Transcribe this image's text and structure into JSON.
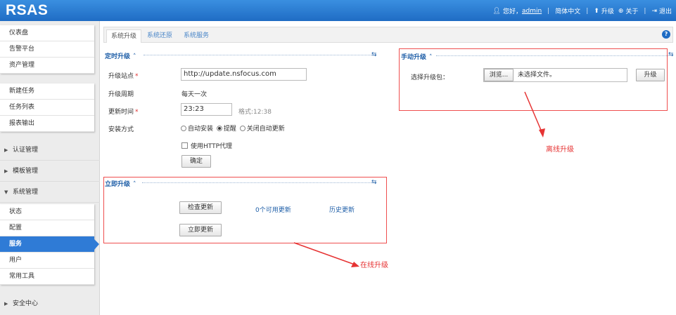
{
  "header": {
    "logo": "RSAS",
    "greeting": "您好，",
    "username": "admin",
    "language": "简体中文",
    "upgrade": "升级",
    "about": "关于",
    "logout": "退出"
  },
  "sidebar": {
    "group1": [
      "仪表盘",
      "告警平台",
      "资产管理"
    ],
    "group2": [
      "新建任务",
      "任务列表",
      "报表输出"
    ],
    "sections": {
      "auth": "认证管理",
      "template": "模板管理",
      "system": "系统管理",
      "security": "安全中心"
    },
    "system_items": [
      "状态",
      "配置",
      "服务",
      "用户",
      "常用工具"
    ],
    "active_item": "服务"
  },
  "tabs": [
    "系统升级",
    "系统还原",
    "系统服务"
  ],
  "help_icon": "?",
  "scheduled": {
    "title": "定时升级",
    "site_label": "升级站点",
    "site_value": "http://update.nsfocus.com",
    "cycle_label": "升级周期",
    "cycle_value": "每天一次",
    "time_label": "更新时间",
    "time_value": "23:23",
    "time_format": "格式:12:38",
    "install_label": "安装方式",
    "install_options": [
      "自动安装",
      "提醒",
      "关闭自动更新"
    ],
    "install_selected": "提醒",
    "proxy_label": "使用HTTP代理",
    "confirm_button": "确定"
  },
  "immediate": {
    "title": "立即升级",
    "check_button": "检查更新",
    "available": "0个可用更新",
    "history": "历史更新",
    "update_button": "立即更新"
  },
  "manual": {
    "title": "手动升级",
    "package_label": "选择升级包：",
    "browse_button": "浏览...",
    "no_file": "未选择文件。",
    "upgrade_button": "升级"
  },
  "annotations": {
    "offline": "离线升级",
    "online": "在线升级"
  },
  "colors": {
    "header": "#2b7fd8",
    "active": "#2f7bd6",
    "annotation": "#e63333"
  }
}
